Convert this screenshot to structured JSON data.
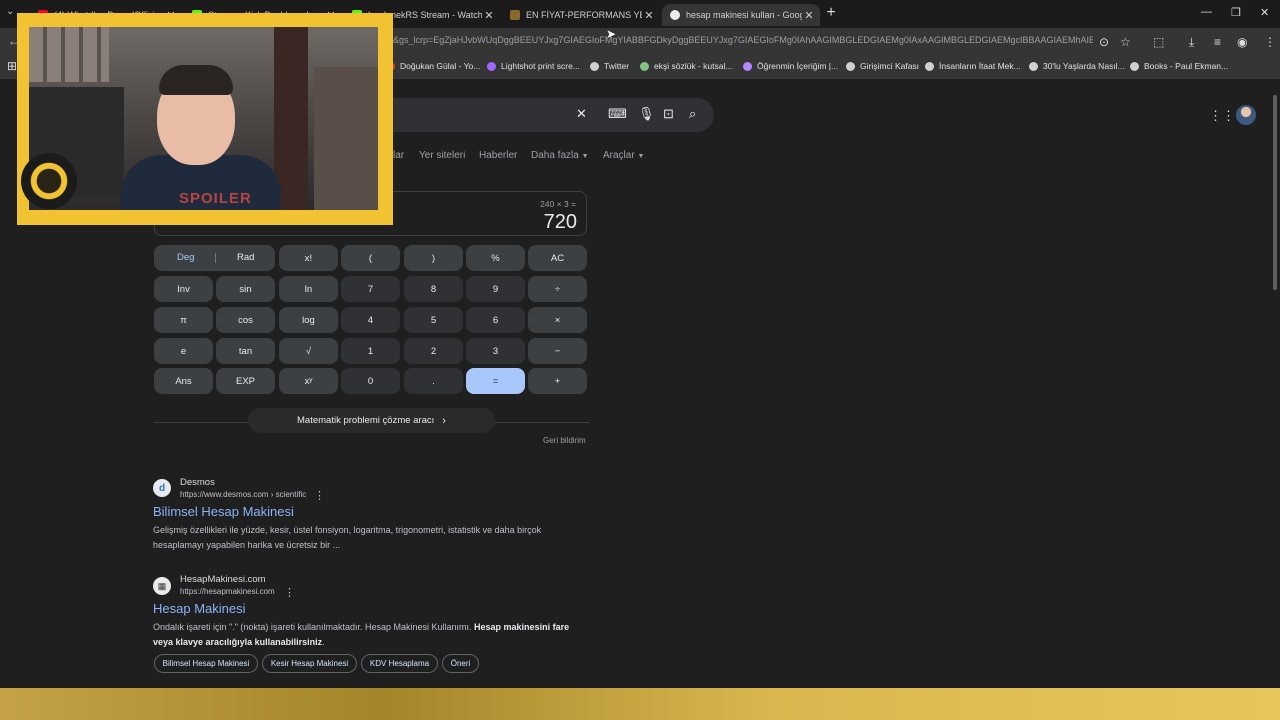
{
  "tabs": [
    {
      "title": "(4) What I've Done (Offici...",
      "color": "#ff0033"
    },
    {
      "title": "Stream - Kick Dashboard",
      "color": "#53fc18"
    },
    {
      "title": "Lord_nekRS Stream - Watch Liv...",
      "color": "#53fc18"
    },
    {
      "title": "EN FİYAT-PERFORMANS YEMEK...",
      "color": "#8a6a2a"
    },
    {
      "title": "hesap makinesi kullan - Google...",
      "color": "#e8eaed"
    }
  ],
  "address": {
    "url": "&gs_lcrp=EgZjaHJvbWUqDggBEEUYJxg7GIAEGIoFMgYIABBFGDkyDggBEEUYJxg7GIAEGIoFMg0IAhAAGIMBGLEDGIAEMg0IAxAAGIMBGLEDGIAEMgcIBBAAGIAEMhAIBR..."
  },
  "bookmarks": [
    {
      "label": "Doğukan Gülal - Yo...",
      "color": "#e53935"
    },
    {
      "label": "Lightshot print scre...",
      "color": "#a066ff"
    },
    {
      "label": "Twitter",
      "color": "#cfcfcf"
    },
    {
      "label": "ekşi sözlük - kutsal...",
      "color": "#81c784"
    },
    {
      "label": "Öğrenmin İçeriğim |...",
      "color": "#b388ff"
    },
    {
      "label": "Girişimci Kafası",
      "color": "#cfcfcf"
    },
    {
      "label": "İnsanların İtaat Mek...",
      "color": "#cfcfcf"
    },
    {
      "label": "30'lu Yaşlarda Nasıl...",
      "color": "#cfcfcf"
    },
    {
      "label": "Books - Paul Ekman...",
      "color": "#cfcfcf"
    }
  ],
  "nav": {
    "partial": "lar",
    "places": "Yer siteleri",
    "news": "Haberler",
    "more": "Daha fazla",
    "tools": "Araçlar"
  },
  "calculator": {
    "expression": "240 × 3 =",
    "result": "720",
    "deg": "Deg",
    "rad": "Rad",
    "keys": {
      "fact": "x!",
      "lparen": "(",
      "rparen": ")",
      "percent": "%",
      "ac": "AC",
      "inv": "Inv",
      "sin": "sin",
      "ln": "ln",
      "seven": "7",
      "eight": "8",
      "nine": "9",
      "divide": "÷",
      "pi": "π",
      "cos": "cos",
      "log": "log",
      "four": "4",
      "five": "5",
      "six": "6",
      "multiply": "×",
      "e": "e",
      "tan": "tan",
      "sqrt": "√",
      "one": "1",
      "two": "2",
      "three": "3",
      "minus": "−",
      "ans": "Ans",
      "exp": "EXP",
      "pow": "xʸ",
      "zero": "0",
      "dot": ".",
      "equals": "=",
      "plus": "+"
    },
    "solver": "Matematik problemi çözme aracı",
    "feedback": "Geri bildirim"
  },
  "results": [
    {
      "site": "Desmos",
      "url": "https://www.desmos.com › scientific",
      "title": "Bilimsel Hesap Makinesi",
      "snippet_1": "Gelişmiş özellikleri ile yüzde, kesir, üstel fonsiyon, logaritma, trigonometri, istatistik ve daha birçok",
      "snippet_2": "hesaplamayı yapabilen harika ve ücretsiz bir ..."
    },
    {
      "site": "HesapMakinesi.com",
      "url": "https://hesapmakinesi.com",
      "title": "Hesap Makinesi",
      "snippet_plain": "Ondalık işareti için \".\" (nokta) işareti kullanılmaktadır. Hesap Makinesi Kullanımı. ",
      "snippet_bold_1": "Hesap makinesini fare",
      "snippet_bold_2": "veya klavye aracılığıyla kullanabilirsiniz",
      "snippet_end": "."
    }
  ],
  "chips": [
    "Bilimsel Hesap Makinesi",
    "Kesir Hesap Makinesi",
    "KDV Hesaplama",
    "Öneri"
  ],
  "webcam": {
    "shirt_text": "SPOILER"
  }
}
